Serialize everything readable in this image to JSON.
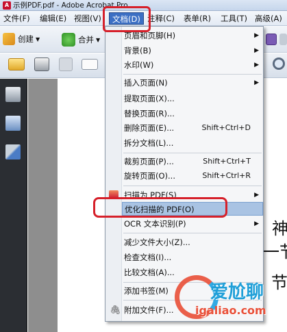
{
  "window": {
    "title": "示例PDF.pdf - Adobe Acrobat Pro"
  },
  "menubar": {
    "items": [
      {
        "label": "文件(F)"
      },
      {
        "label": "编辑(E)"
      },
      {
        "label": "视图(V)"
      },
      {
        "label": "文档(D)"
      },
      {
        "label": "注释(C)"
      },
      {
        "label": "表单(R)"
      },
      {
        "label": "工具(T)"
      },
      {
        "label": "高级(A)"
      }
    ]
  },
  "toolbar": {
    "create_label": "创建",
    "combine_label": "合并"
  },
  "dropdown": {
    "items": [
      {
        "label": "页眉和页脚(H)",
        "shortcut": "",
        "submenu": true
      },
      {
        "label": "背景(B)",
        "shortcut": "",
        "submenu": true
      },
      {
        "label": "水印(W)",
        "shortcut": "",
        "submenu": true
      },
      {
        "label": "插入页面(N)",
        "shortcut": "",
        "submenu": true
      },
      {
        "label": "提取页面(X)...",
        "shortcut": "",
        "submenu": false
      },
      {
        "label": "替换页面(R)...",
        "shortcut": "",
        "submenu": false
      },
      {
        "label": "删除页面(E)...",
        "shortcut": "Shift+Ctrl+D",
        "submenu": false
      },
      {
        "label": "拆分文档(L)...",
        "shortcut": "",
        "submenu": false
      },
      {
        "label": "裁剪页面(P)...",
        "shortcut": "Shift+Ctrl+T",
        "submenu": false
      },
      {
        "label": "旋转页面(O)...",
        "shortcut": "Shift+Ctrl+R",
        "submenu": false
      },
      {
        "label": "扫描为 PDF(S)",
        "shortcut": "",
        "submenu": true
      },
      {
        "label": "优化扫描的 PDF(O)",
        "shortcut": "",
        "submenu": false
      },
      {
        "label": "OCR 文本识别(P)",
        "shortcut": "",
        "submenu": true
      },
      {
        "label": "减少文件大小(Z)...",
        "shortcut": "",
        "submenu": false
      },
      {
        "label": "检查文档(I)...",
        "shortcut": "",
        "submenu": false
      },
      {
        "label": "比较文档(A)...",
        "shortcut": "",
        "submenu": false
      },
      {
        "label": "添加书签(M)",
        "shortcut": "",
        "submenu": false
      },
      {
        "label": "附加文件(F)...",
        "shortcut": "",
        "submenu": false
      }
    ]
  },
  "document": {
    "line1": "神",
    "line2": "一节",
    "line3": "节"
  },
  "watermark": {
    "text_cn": "爱尬聊",
    "text_url": "igaliao.com"
  },
  "colors": {
    "menu_highlight": "#3c6fc4",
    "item_highlight": "#a9c3e3",
    "annotation_red": "#d6202a"
  }
}
